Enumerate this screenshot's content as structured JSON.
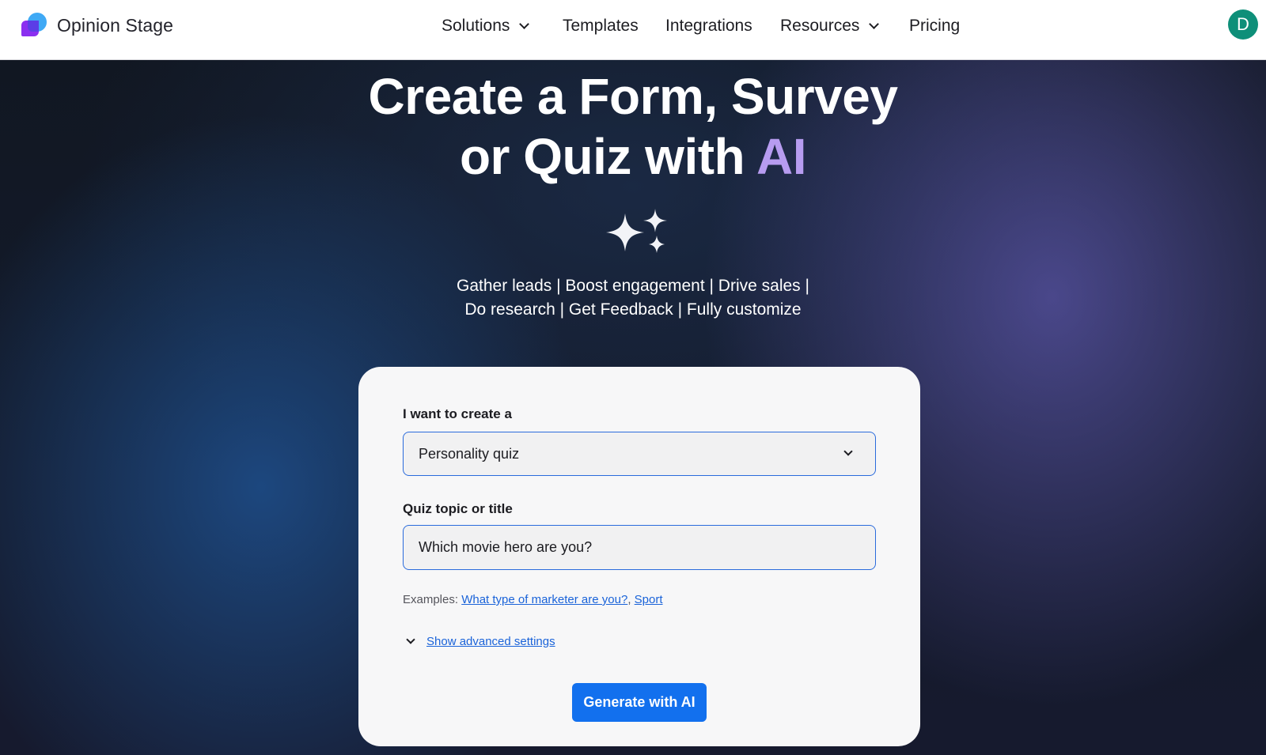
{
  "brand": {
    "name": "Opinion Stage"
  },
  "nav": {
    "items": [
      {
        "label": "Solutions",
        "has_dropdown": true
      },
      {
        "label": "Templates",
        "has_dropdown": false
      },
      {
        "label": "Integrations",
        "has_dropdown": false
      },
      {
        "label": "Resources",
        "has_dropdown": true
      },
      {
        "label": "Pricing",
        "has_dropdown": false
      }
    ],
    "avatar_initial": "D",
    "avatar_color": "#0e8f79"
  },
  "hero": {
    "headline_line1": "Create a Form, Survey",
    "headline_line2_prefix": "or Quiz with ",
    "headline_line2_accent": "AI",
    "accent_color": "#b79cf0",
    "icon": "sparkles-icon",
    "tagline_line1": "Gather leads | Boost engagement | Drive sales |",
    "tagline_line2": "Do research | Get Feedback | Fully customize"
  },
  "form": {
    "create_label": "I want to create a",
    "create_value": "Personality quiz",
    "topic_label": "Quiz topic or title",
    "topic_value": "Which movie hero are you?",
    "examples_prefix": "Examples: ",
    "examples": [
      "What type of marketer are you?",
      "Sport"
    ],
    "examples_separator": ", ",
    "advanced_label": "Show advanced settings",
    "generate_label": "Generate with AI",
    "button_color": "#1270ee",
    "link_color": "#1a63d9"
  }
}
